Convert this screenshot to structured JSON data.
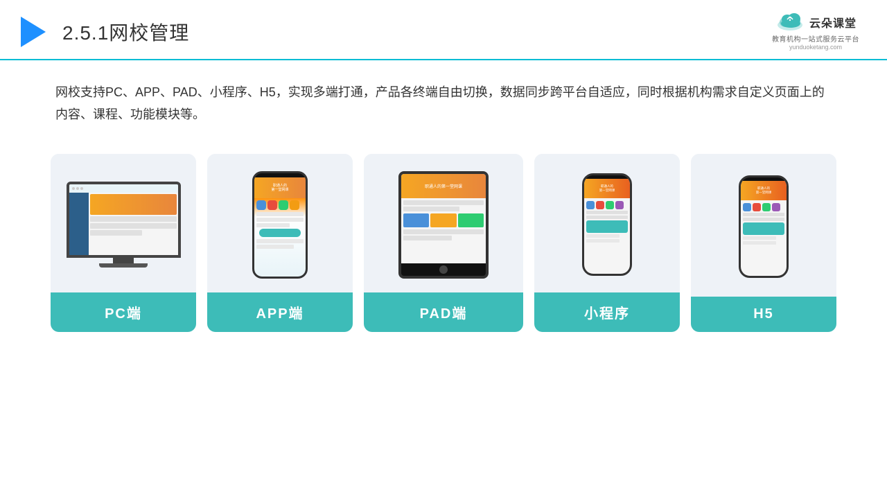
{
  "header": {
    "title_number": "2.5.1",
    "title_text": "网校管理",
    "logo_main": "云朵课堂",
    "logo_url": "yunduoketang.com",
    "logo_tagline": "教育机构一站\n式服务云平台"
  },
  "description": {
    "text": "网校支持PC、APP、PAD、小程序、H5，实现多端打通，产品各终端自由切换，数据同步跨平台自适应，同时根据机构需求自定义页面上的内容、课程、功能模块等。"
  },
  "cards": [
    {
      "id": "pc",
      "label": "PC端"
    },
    {
      "id": "app",
      "label": "APP端"
    },
    {
      "id": "pad",
      "label": "PAD端"
    },
    {
      "id": "miniprogram",
      "label": "小程序"
    },
    {
      "id": "h5",
      "label": "H5"
    }
  ],
  "colors": {
    "accent": "#3dbcb8",
    "header_line": "#00bcd4",
    "card_bg": "#eef2f7",
    "play_icon": "#1e90ff"
  }
}
